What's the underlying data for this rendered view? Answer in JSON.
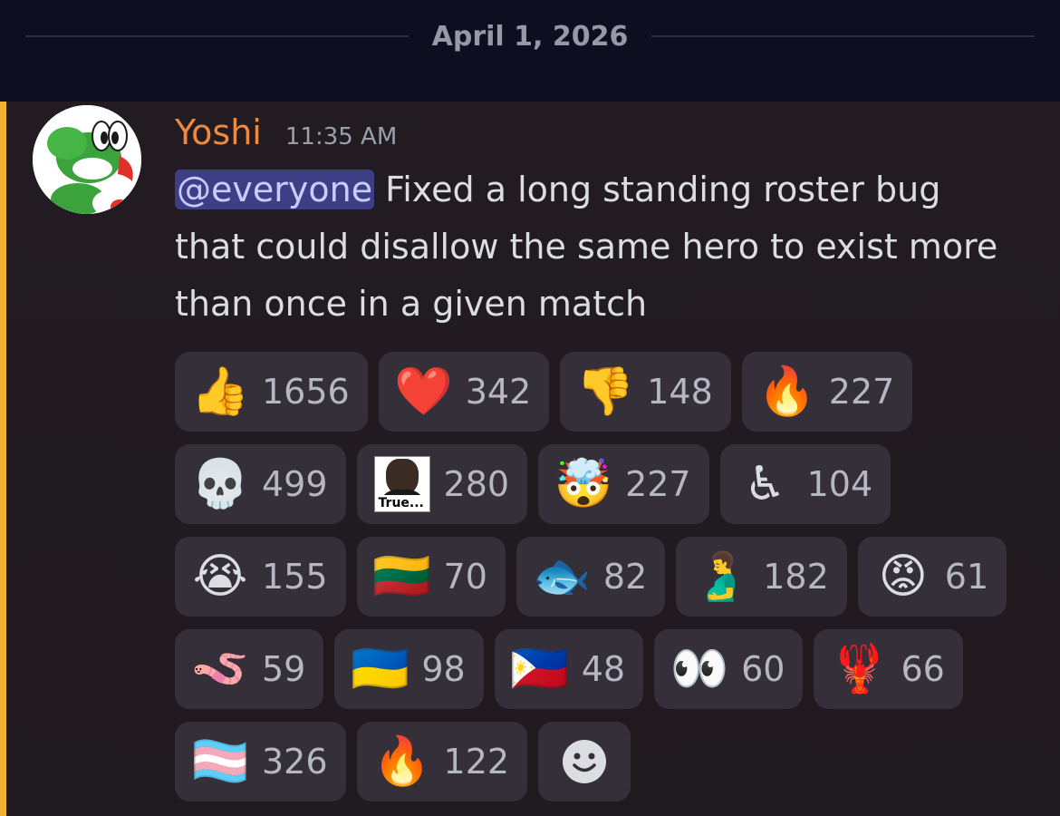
{
  "date_divider": "April 1, 2026",
  "message": {
    "username": "Yoshi",
    "timestamp": "11:35 AM",
    "mention": "@everyone",
    "text": " Fixed a long standing roster bug that could disallow the same hero to exist more than once in a given match"
  },
  "reactions": [
    [
      {
        "emoji": "👍",
        "name": "thumbs-up",
        "count": "1656"
      },
      {
        "emoji": "❤️",
        "name": "red-heart",
        "count": "342"
      },
      {
        "emoji": "👎",
        "name": "thumbs-down",
        "count": "148"
      },
      {
        "emoji": "🔥",
        "name": "fire",
        "count": "227"
      }
    ],
    [
      {
        "emoji": "💀",
        "name": "skull",
        "count": "499"
      },
      {
        "emoji": "",
        "name": "true-custom",
        "caption": "True...",
        "count": "280"
      },
      {
        "emoji": "🤯",
        "name": "exploding-head",
        "count": "227"
      },
      {
        "emoji": "♿",
        "name": "wheelchair",
        "count": "104"
      }
    ],
    [
      {
        "emoji": "😭",
        "name": "loudly-crying",
        "count": "155"
      },
      {
        "emoji": "🇱🇹",
        "name": "flag-lithuania",
        "count": "70"
      },
      {
        "emoji": "🐟",
        "name": "fish",
        "count": "82"
      },
      {
        "emoji": "🫃",
        "name": "pregnant-man",
        "count": "182"
      },
      {
        "emoji": "😡",
        "name": "angry-face",
        "count": "61"
      }
    ],
    [
      {
        "emoji": "🪱",
        "name": "worm",
        "count": "59"
      },
      {
        "emoji": "🇺🇦",
        "name": "flag-ukraine",
        "count": "98"
      },
      {
        "emoji": "🇵🇭",
        "name": "flag-philippines",
        "count": "48"
      },
      {
        "emoji": "👀",
        "name": "eyes",
        "count": "60"
      },
      {
        "emoji": "🦞",
        "name": "lobster",
        "count": "66"
      }
    ],
    [
      {
        "emoji": "🏳️‍⚧️",
        "name": "transgender-flag",
        "count": "326"
      },
      {
        "emoji": "🔥",
        "name": "fire-custom",
        "count": "122"
      }
    ]
  ],
  "colors": {
    "username": "#f0883e",
    "mention_bar": "#f0b232",
    "mention_bg": "#3c3f86"
  }
}
